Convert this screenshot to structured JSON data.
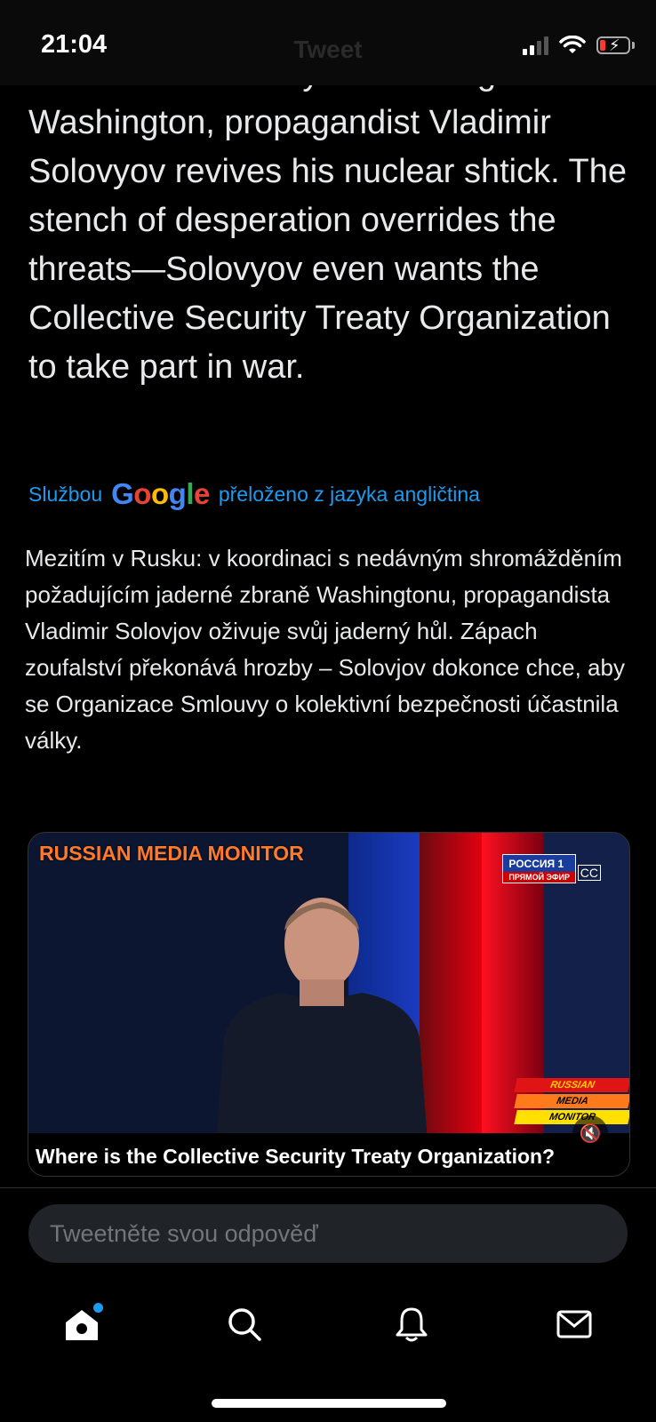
{
  "status_bar": {
    "time": "21:04",
    "nav_title_ghost": "Tweet"
  },
  "tweet": {
    "original_text": "with the recent rally demanding to nuke Washington, propagandist Vladimir Solovyov revives his nuclear shtick. The stench of desperation overrides the threats—Solovyov even wants the Collective Security Treaty Organization to take part in war.",
    "translated_by_prefix": "Službou",
    "translated_by_brand": "Google",
    "translated_by_suffix": "přeloženo z jazyka angličtina",
    "translated_text": "Mezitím v Rusku: v koordinaci s nedávným shromážděním požadujícím jaderné zbraně Washingtonu, propagandista Vladimir Solovjov oživuje svůj jaderný hůl. Zápach zoufalství překonává hrozby – Solovjov dokonce chce, aby se Organizace Smlouvy o kolektivní bezpečnosti účastnila války."
  },
  "video": {
    "overlay_header": "RUSSIAN MEDIA MONITOR",
    "channel_badge": "РОССИЯ 1",
    "channel_badge_sub": "ПРЯМОЙ ЭФИР",
    "stripe_1": "RUSSIAN",
    "stripe_2": "MEDIA",
    "stripe_3": "MONITOR",
    "caption": "Where is the Collective Security Treaty Organization?",
    "mute_icon": "speaker-muted-icon"
  },
  "reply": {
    "placeholder": "Tweetněte svou odpověď"
  },
  "tab_bar": {
    "items": [
      "home-icon",
      "search-icon",
      "bell-icon",
      "mail-icon"
    ],
    "accent": "#1d9bf0"
  }
}
